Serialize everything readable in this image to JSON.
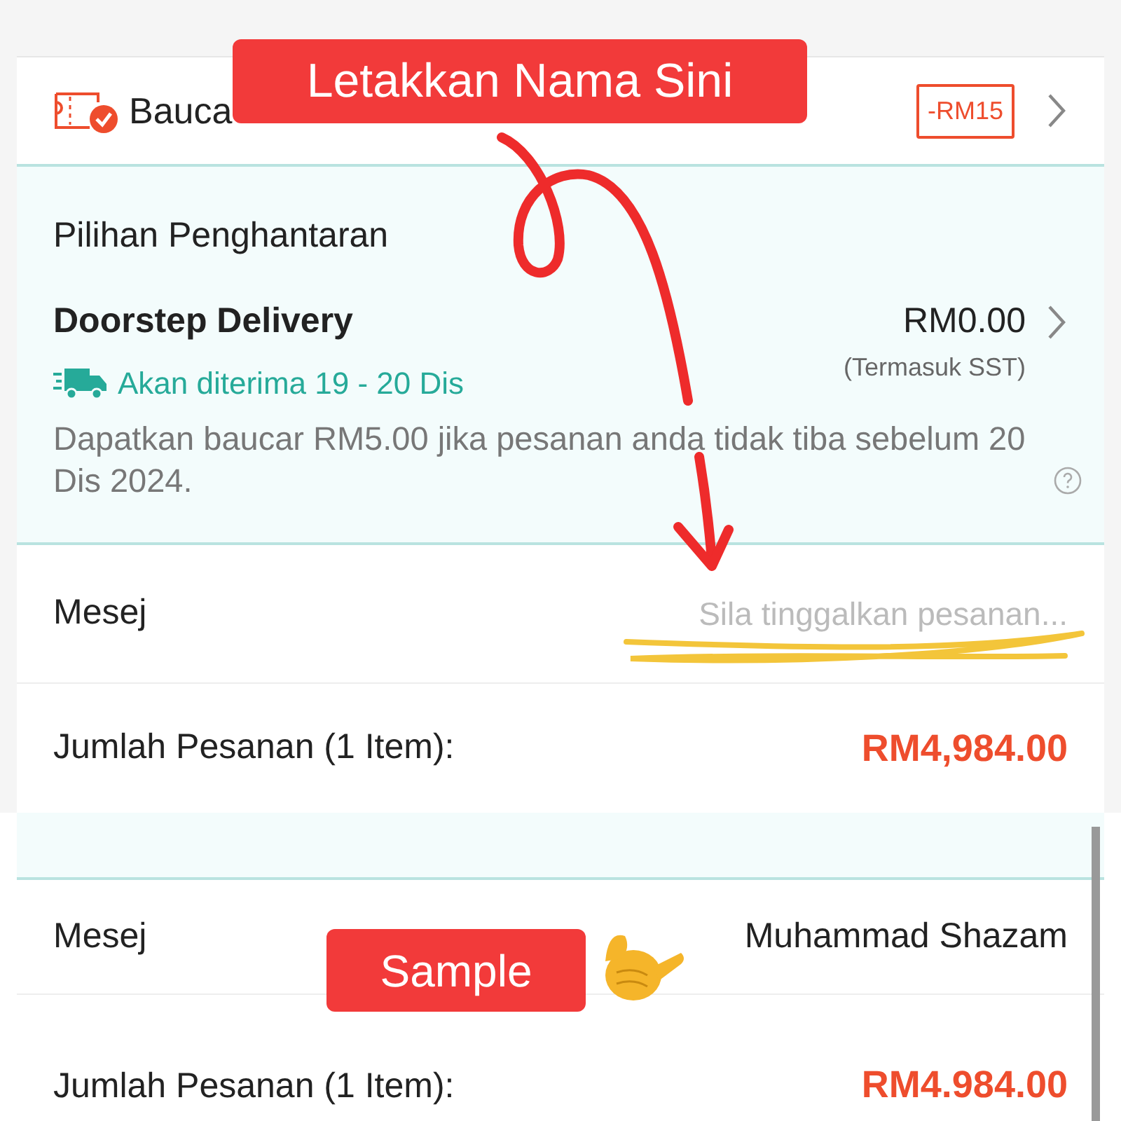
{
  "annotations": [
    {
      "kind": "label",
      "text": "Letakkan Nama Sini"
    },
    {
      "kind": "label",
      "text": "Sample"
    }
  ],
  "top_screen": {
    "voucher": {
      "label": "Bauca",
      "discount": "-RM15"
    },
    "delivery": {
      "heading": "Pilihan Penghantaran",
      "method": "Doorstep Delivery",
      "price": "RM0.00",
      "tax_note": "(Termasuk SST)",
      "eta": "Akan diterima 19 - 20 Dis",
      "guarantee": "Dapatkan baucar RM5.00 jika pesanan anda tidak tiba sebelum 20 Dis 2024."
    },
    "message": {
      "label": "Mesej",
      "placeholder": "Sila tinggalkan pesanan..."
    },
    "total": {
      "label": "Jumlah Pesanan (1 Item):",
      "amount": "RM4,984.00"
    }
  },
  "bottom_screen": {
    "message": {
      "label": "Mesej",
      "value": "Muhammad Shazam"
    },
    "total": {
      "label": "Jumlah Pesanan (1 Item):",
      "amount": "RM4.984.00"
    }
  }
}
